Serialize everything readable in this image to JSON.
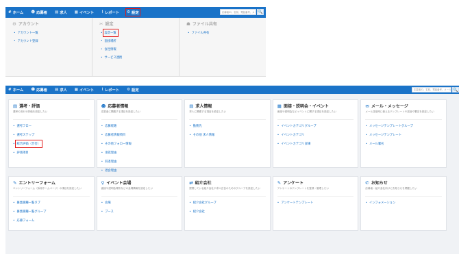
{
  "top": {
    "nav": [
      {
        "icon": "#",
        "label": "ホーム"
      },
      {
        "icon": "☻",
        "label": "応募者"
      },
      {
        "icon": "▤",
        "label": "求人"
      },
      {
        "icon": "▦",
        "label": "イベント"
      },
      {
        "icon": "⌇",
        "label": "レポート"
      },
      {
        "icon": "⚙",
        "label": "設定"
      }
    ],
    "search_placeholder": "応募者ID、名前、電話番号、メール",
    "search_icon": "🔍",
    "dropdown": {
      "account": {
        "icon": "⚙",
        "title": "アカウント",
        "links": [
          "アカウント一覧",
          "アカウント登録"
        ]
      },
      "settings": {
        "icon": "✂",
        "title": "設定",
        "links": [
          "設定一覧",
          "面接場所",
          "会社情報",
          "サービス連携"
        ]
      },
      "files": {
        "icon": "☗",
        "title": "ファイル共有",
        "links": [
          "ファイル共有"
        ]
      }
    }
  },
  "main": {
    "nav": [
      {
        "icon": "#",
        "label": "ホーム"
      },
      {
        "icon": "☻",
        "label": "応募者"
      },
      {
        "icon": "▤",
        "label": "求人"
      },
      {
        "icon": "▦",
        "label": "イベント"
      },
      {
        "icon": "⌇",
        "label": "レポート"
      },
      {
        "icon": "⚙",
        "label": "設定"
      }
    ],
    "search_placeholder": "応募者ID、名前、電話番号、メール",
    "search_icon": "🔍",
    "cards": [
      {
        "icon": "▤",
        "title": "選考・評価",
        "desc": "選考の流れや評価を設定したい",
        "links": [
          "選考フロー",
          "選考ステップ",
          "総合評価（合否）",
          "評価項目"
        ]
      },
      {
        "icon": "☻",
        "title": "応募者情報",
        "desc": "応募者に関連する項目を設定したい",
        "links": [
          "応募経路",
          "応募者情報項目",
          "その他フォロー情報",
          "承諾理由",
          "辞退理由",
          "退会理由",
          "選考エリア"
        ]
      },
      {
        "icon": "▤",
        "title": "求人情報",
        "desc": "求人に関連する項目を設定したい",
        "links": [
          "勤務先",
          "その他 求人情報"
        ]
      },
      {
        "icon": "▦",
        "title": "面接・説明会・イベント",
        "desc": "面接や説明会などイベントに関する項目を設定したい",
        "links": [
          "イベントカテゴリグループ",
          "イベントカテゴリ",
          "イベントカテゴリ詳細"
        ]
      },
      {
        "icon": "✉",
        "title": "メール・メッセージ",
        "desc": "メール送信時に使えるテンプレートや送信や署名を設定したい",
        "links": [
          "メッセージテンプレートグループ",
          "メッセージテンプレート",
          "メール署名"
        ]
      },
      {
        "icon": "✎",
        "title": "エントリーフォーム",
        "desc": "エントリーフォーム（採用ホームページ）の項目を設定したい",
        "links": [
          "募集職種一覧タブ",
          "募集職種一覧グループ",
          "応募フォーム"
        ]
      },
      {
        "icon": "⚲",
        "title": "イベント会場",
        "desc": "面接や説明会場所などの会場情報を設定したい",
        "links": [
          "会場",
          "ブース"
        ]
      },
      {
        "icon": "⇄",
        "title": "紹介会社",
        "desc": "提携している紹介会社や求人広告のためのグループを設定したい",
        "links": [
          "紹介会社グループ",
          "紹介会社"
        ]
      },
      {
        "icon": "✎",
        "title": "アンケート",
        "desc": "アンケートのテンプレートを登録・管理したい",
        "links": [
          "アンケートテンプレート"
        ]
      },
      {
        "icon": "✆",
        "title": "お知らせ",
        "desc": "応募者・紹介会社向けにお知らせを掲載したい",
        "links": [
          "インフォメーション"
        ]
      }
    ]
  }
}
